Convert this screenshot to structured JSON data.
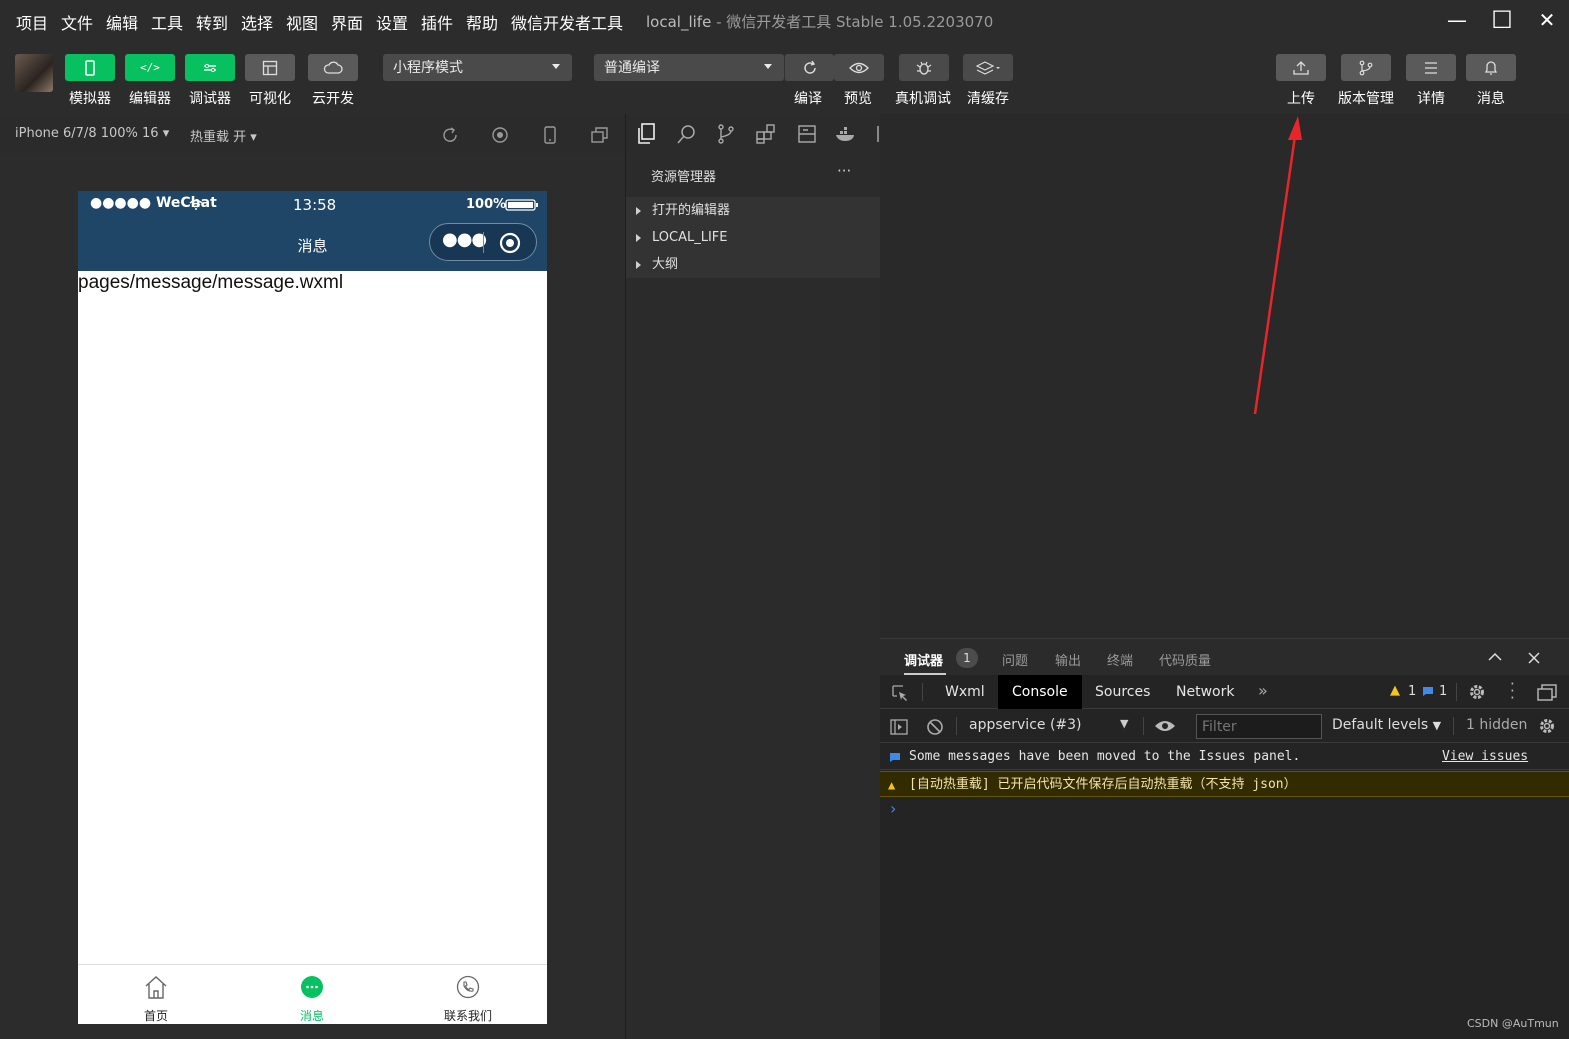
{
  "menubar": {
    "items": [
      "项目",
      "文件",
      "编辑",
      "工具",
      "转到",
      "选择",
      "视图",
      "界面",
      "设置",
      "插件",
      "帮助",
      "微信开发者工具"
    ],
    "project": "local_life",
    "separator": " - ",
    "app_title": "微信开发者工具 Stable 1.05.2203070"
  },
  "window_controls": {
    "minimize": "—",
    "maximize": "☐",
    "close": "✕"
  },
  "toolbar": {
    "left_buttons": [
      {
        "label": "模拟器",
        "icon": "phone-icon",
        "style": "green"
      },
      {
        "label": "编辑器",
        "icon": "code-icon",
        "style": "green"
      },
      {
        "label": "调试器",
        "icon": "sliders-icon",
        "style": "green"
      },
      {
        "label": "可视化",
        "icon": "layout-icon",
        "style": "gray"
      },
      {
        "label": "云开发",
        "icon": "cloud-icon",
        "style": "gray"
      }
    ],
    "mode_select": "小程序模式",
    "compile_select": "普通编译",
    "center_buttons": [
      {
        "label": "编译",
        "icon": "refresh-icon"
      },
      {
        "label": "预览",
        "icon": "eye-icon"
      },
      {
        "label": "真机调试",
        "icon": "bug-icon"
      },
      {
        "label": "清缓存",
        "icon": "layers-icon"
      }
    ],
    "right_buttons": [
      {
        "label": "上传",
        "icon": "upload-icon"
      },
      {
        "label": "版本管理",
        "icon": "branch-icon"
      },
      {
        "label": "详情",
        "icon": "menu-icon"
      },
      {
        "label": "消息",
        "icon": "bell-icon"
      }
    ]
  },
  "simulator_bar": {
    "device": "iPhone 6/7/8 100% 16",
    "hot_reload": "热重载 开"
  },
  "phone": {
    "status": {
      "signal": "●●●●● WeChat",
      "time": "13:58",
      "battery": "100%"
    },
    "nav_title": "消息",
    "content": "pages/message/message.wxml",
    "tabs": [
      {
        "label": "首页",
        "icon": "home-icon",
        "active": false
      },
      {
        "label": "消息",
        "icon": "chat-icon",
        "active": true
      },
      {
        "label": "联系我们",
        "icon": "phone-call-icon",
        "active": false
      }
    ],
    "colors": {
      "nav": "#1f4567",
      "active_tab": "#07c160"
    }
  },
  "explorer": {
    "title": "资源管理器",
    "more": "···",
    "items": [
      "打开的编辑器",
      "LOCAL_LIFE",
      "大纲"
    ]
  },
  "devtools": {
    "tabs": [
      {
        "label": "调试器",
        "badge": "1"
      },
      {
        "label": "问题"
      },
      {
        "label": "输出"
      },
      {
        "label": "终端"
      },
      {
        "label": "代码质量"
      }
    ],
    "console_tabs": [
      "Wxml",
      "Console",
      "Sources",
      "Network"
    ],
    "more_tabs": "»",
    "warn_count": "1",
    "info_count": "1",
    "context": "appservice (#3)",
    "filter_placeholder": "Filter",
    "levels": "Default levels",
    "hidden": "1 hidden",
    "messages": [
      {
        "type": "info",
        "text": "Some messages have been moved to the Issues panel.",
        "link": "View issues"
      },
      {
        "type": "warning",
        "text": "[自动热重载] 已开启代码文件保存后自动热重载（不支持 json）"
      }
    ],
    "prompt": "›"
  },
  "watermark": "CSDN @AuTmun"
}
